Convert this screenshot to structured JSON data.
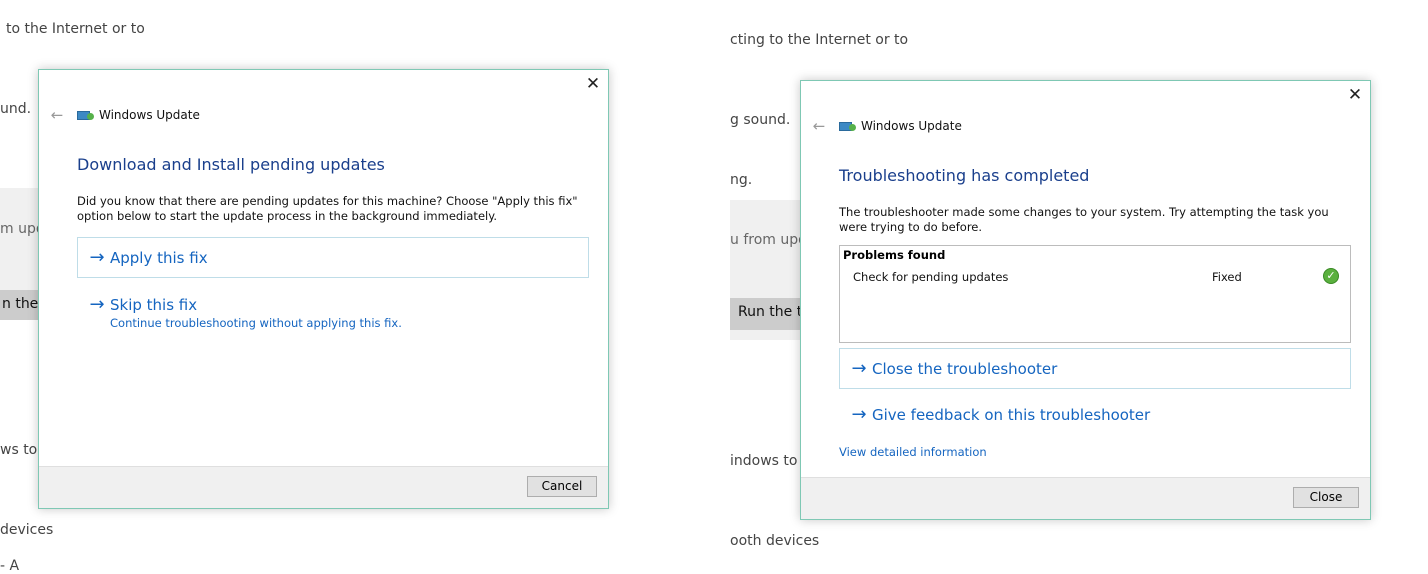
{
  "background": {
    "left": {
      "texts": [
        "to the Internet or to",
        "und.",
        "m upd",
        "ws to s",
        "devices",
        "- A"
      ],
      "button": "n the t"
    },
    "right": {
      "texts": [
        "cting to the Internet or to",
        "g sound.",
        "ng.",
        "u from upd",
        "indows to s",
        "ooth devices"
      ],
      "button": "Run the t"
    }
  },
  "dialog_left": {
    "app_title": "Windows Update",
    "back_glyph": "←",
    "close_glyph": "✕",
    "heading": "Download and Install pending updates",
    "description": "Did you know that there are pending updates for this machine? Choose \"Apply this fix\" option below to start the update process in the background immediately.",
    "options": [
      {
        "arrow": "→",
        "title": "Apply this fix",
        "subtitle": ""
      },
      {
        "arrow": "→",
        "title": "Skip this fix",
        "subtitle": "Continue troubleshooting without applying this fix."
      }
    ],
    "cancel_label": "Cancel"
  },
  "dialog_right": {
    "app_title": "Windows Update",
    "back_glyph": "←",
    "close_glyph": "✕",
    "heading": "Troubleshooting has completed",
    "description": "The troubleshooter made some changes to your system. Try attempting the task you were trying to do before.",
    "problems_header": "Problems found",
    "problems": [
      {
        "name": "Check for pending updates",
        "status": "Fixed",
        "icon": "check-circle-icon",
        "check_glyph": "✓"
      }
    ],
    "options": [
      {
        "arrow": "→",
        "title": "Close the troubleshooter"
      },
      {
        "arrow": "→",
        "title": "Give feedback on this troubleshooter"
      }
    ],
    "details_link": "View detailed information",
    "close_label": "Close"
  },
  "colors": {
    "accent_blue": "#1565c0",
    "heading_blue": "#1a3f8c",
    "dialog_border": "#7fc8b4",
    "success_green": "#5ab03e"
  }
}
